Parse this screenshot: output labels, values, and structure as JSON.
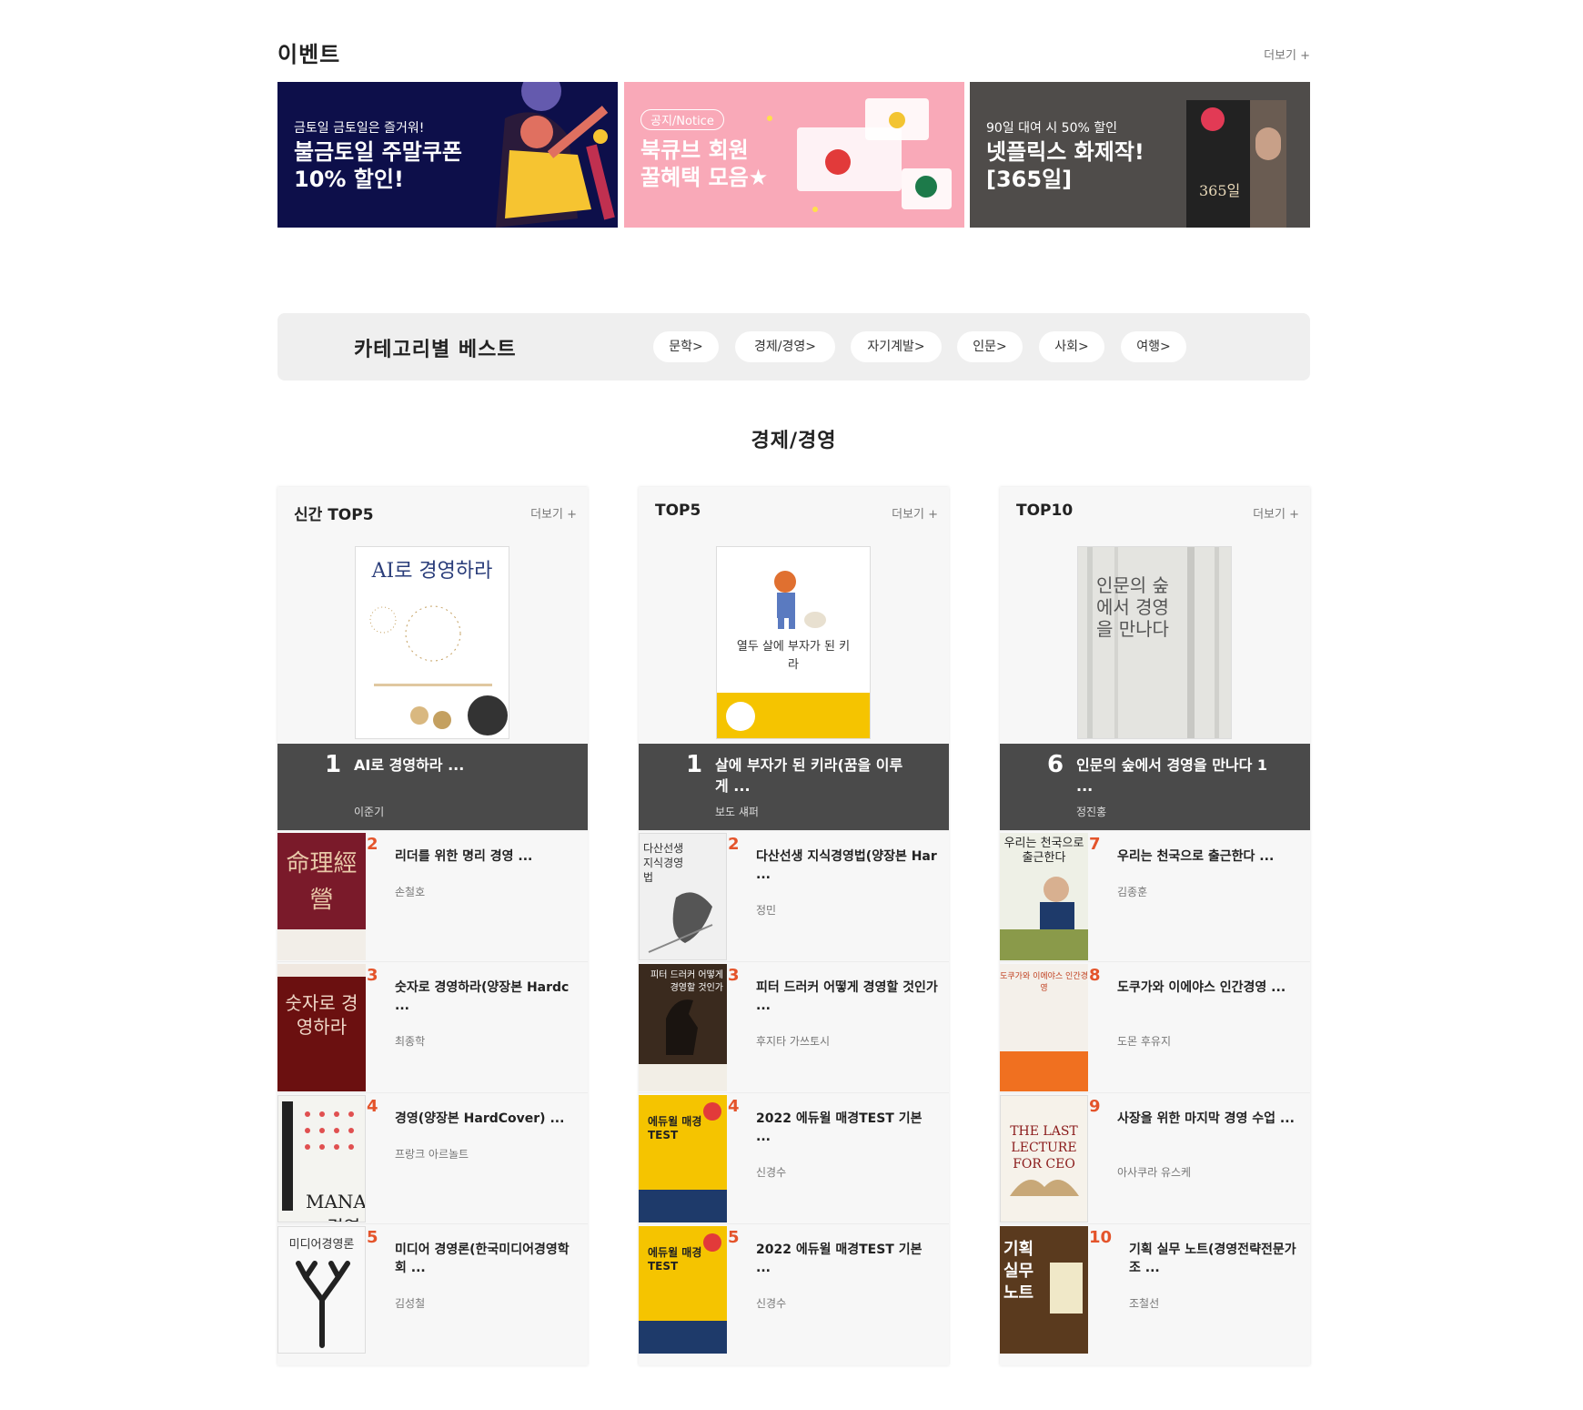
{
  "events": {
    "title": "이벤트",
    "more": "더보기 +",
    "banners": [
      {
        "small": "금토일 금토일은 즐거워!",
        "line1": "불금토일 주말쿠폰",
        "line2": "10% 할인!",
        "bg": "#0d0f4a"
      },
      {
        "pill": "공지/Notice",
        "line1": "북큐브 회원",
        "line2": "꿀혜택 모음★",
        "bg": "#f9a9b8"
      },
      {
        "small": "90일 대여 시 50% 할인",
        "line1": "넷플릭스 화제작!",
        "line2": "[365일]",
        "cover_text": "365일",
        "bg": "#4f4c4a"
      }
    ]
  },
  "category_best": {
    "title": "카테고리별 베스트",
    "pills": [
      "문학>",
      "경제/경영>",
      "자기계발>",
      "인문>",
      "사회>",
      "여행>"
    ]
  },
  "section_title": "경제/경영",
  "columns": [
    {
      "title": "신간 TOP5",
      "more": "더보기 +",
      "hero": {
        "rank": "1",
        "name": "AI로 경영하라 ...",
        "author": "이준기",
        "cover_title": "AI로 경영하라"
      },
      "items": [
        {
          "rank": "2",
          "name": "리더를 위한 명리 경영 ...",
          "author": "손철호",
          "cover_title": "命理經營",
          "cover_color": "#7a1a2a"
        },
        {
          "rank": "3",
          "name": "숫자로 경영하라(양장본 Hardc ...",
          "author": "최종학",
          "cover_title": "숫자로 경영하라",
          "cover_color": "#6b1010"
        },
        {
          "rank": "4",
          "name": "경영(양장본 HardCover) ...",
          "author": "프랑크 아르놀트",
          "cover_title": "MANAGEMENT 경영",
          "cover_color": "#f4f4f0"
        },
        {
          "rank": "5",
          "name": "미디어 경영론(한국미디어경영학회 ...",
          "author": "김성철",
          "cover_title": "미디어경영론",
          "cover_color": "#f8f8f8"
        }
      ]
    },
    {
      "title": "TOP5",
      "more": "더보기 +",
      "hero": {
        "rank": "1",
        "name": "살에 부자가 된 키라(꿈을 이루게 ...",
        "author": "보도 섀퍼",
        "cover_title": "열두 살에 부자가 된 키라"
      },
      "items": [
        {
          "rank": "2",
          "name": "다산선생 지식경영법(양장본 Har ...",
          "author": "정민",
          "cover_title": "다산선생 지식경영법",
          "cover_color": "#f0f0f0"
        },
        {
          "rank": "3",
          "name": "피터 드러커 어떻게 경영할 것인가 ...",
          "author": "후지타 가쓰토시",
          "cover_title": "피터 드러커 어떻게 경영할 것인가",
          "cover_color": "#3a2a1e"
        },
        {
          "rank": "4",
          "name": "2022 에듀윌 매경TEST 기본 ...",
          "author": "신경수",
          "cover_title": "에듀윌 매경TEST",
          "cover_color": "#f5c400"
        },
        {
          "rank": "5",
          "name": "2022 에듀윌 매경TEST 기본 ...",
          "author": "신경수",
          "cover_title": "에듀윌 매경TEST",
          "cover_color": "#f5c400"
        }
      ]
    },
    {
      "title": "TOP10",
      "more": "더보기 +",
      "hero": {
        "rank": "6",
        "name": "인문의 숲에서 경영을 만나다 1 ...",
        "author": "정진홍",
        "cover_title": "인문의 숲에서 경영을 만나다"
      },
      "items": [
        {
          "rank": "7",
          "name": "우리는 천국으로 출근한다 ...",
          "author": "김종훈",
          "cover_title": "우리는 천국으로 출근한다",
          "cover_color": "#eef0e6"
        },
        {
          "rank": "8",
          "name": "도쿠가와 이에야스 인간경영 ...",
          "author": "도몬 후유지",
          "cover_title": "도쿠가와 이에야스 인간경영",
          "cover_color": "#f4f0ea"
        },
        {
          "rank": "9",
          "name": "사장을 위한 마지막 경영 수업 ...",
          "author": "아사쿠라 유스케",
          "cover_title": "THE LAST LECTURE FOR CEO",
          "cover_color": "#f6f2ea"
        },
        {
          "rank": "10",
          "name": "기획 실무 노트(경영전략전문가 조 ...",
          "author": "조철선",
          "cover_title": "기획 실무노트",
          "cover_color": "#5a3a1e"
        }
      ]
    }
  ]
}
